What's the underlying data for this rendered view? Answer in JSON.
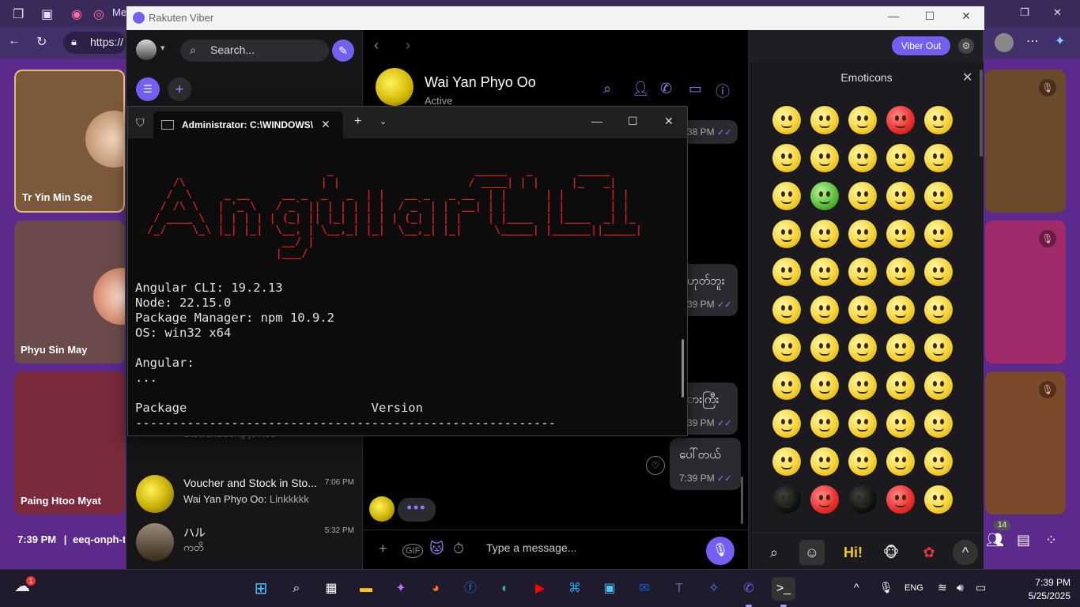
{
  "browser": {
    "url": "https://",
    "tab_label": "Me"
  },
  "meet": {
    "tiles": [
      {
        "name": "Tr Yin Min Soe"
      },
      {
        "name": "Phyu Sin May"
      },
      {
        "name": "Paing Htoo Myat"
      }
    ],
    "footer_time": "7:39 PM",
    "footer_separator": "|",
    "meeting_code": "eeq-onph-t",
    "participant_count": "14"
  },
  "viber": {
    "window_title": "Rakuten Viber",
    "search_placeholder": "Search...",
    "viber_out_label": "Viber Out",
    "chats": [
      {
        "title": "Voucher and Stock in Sto...",
        "time": "7:06 PM",
        "sender": "Wai Yan Phyo Oo:",
        "message": "Linkkkkk"
      },
      {
        "title": "ハル",
        "time": "5:32 PM",
        "sender": "",
        "message": "ကတိ"
      }
    ],
    "joined_notice": "Saiwunuueng joined",
    "contact": {
      "name": "Wai Yan Phyo Oo",
      "status": "Active"
    },
    "messages": [
      {
        "partial_text": "",
        "time": "38 PM"
      },
      {
        "partial_text": "ဟုတ်ဘူး",
        "time": "39 PM"
      },
      {
        "partial_text": "ားကြီး",
        "time": "39 PM"
      },
      {
        "text": "ပေါ်တယ်",
        "time": "7:39 PM"
      }
    ],
    "typing_indicator": "•••",
    "message_placeholder": "Type a message...",
    "emoticons_title": "Emoticons"
  },
  "terminal": {
    "tab_title": "Administrator:  C:\\WINDOWS\\",
    "ascii_art": "                             _                      _____   _       _____\n     /\\                     | |                    / ____| | |     |_   _|\n    /  \\     _ __     __ _  _   _  | |   __ _   _ __  | |      | |       | |\n   / /\\ \\   | '_ \\   / _` || | | | | |  / _` | | '__| | |      | |       | |\n  / ____ \\  | | | | | (_| || |_| | | | | (_| | | |    | |____  | |____  _| |_\n /_/    \\_\\ |_| |_|  \\__, | \\__,_| |_|  \\__,_| |_|     \\_____| |______||_____|\n                      __/ |\n                     |___/",
    "output_lines": [
      "Angular CLI: 19.2.13",
      "Node: 22.15.0",
      "Package Manager: npm 10.9.2",
      "OS: win32 x64",
      "",
      "Angular:",
      "...",
      "",
      "Package                         Version",
      "---------------------------------------------------------"
    ]
  },
  "taskbar": {
    "weather_badge": "1",
    "language": "ENG",
    "time": "7:39 PM",
    "date": "5/25/2025"
  },
  "colors": {
    "viber_accent": "#7360f2",
    "terminal_ascii": "#d42020",
    "meet_background": "#5b2a8c"
  }
}
